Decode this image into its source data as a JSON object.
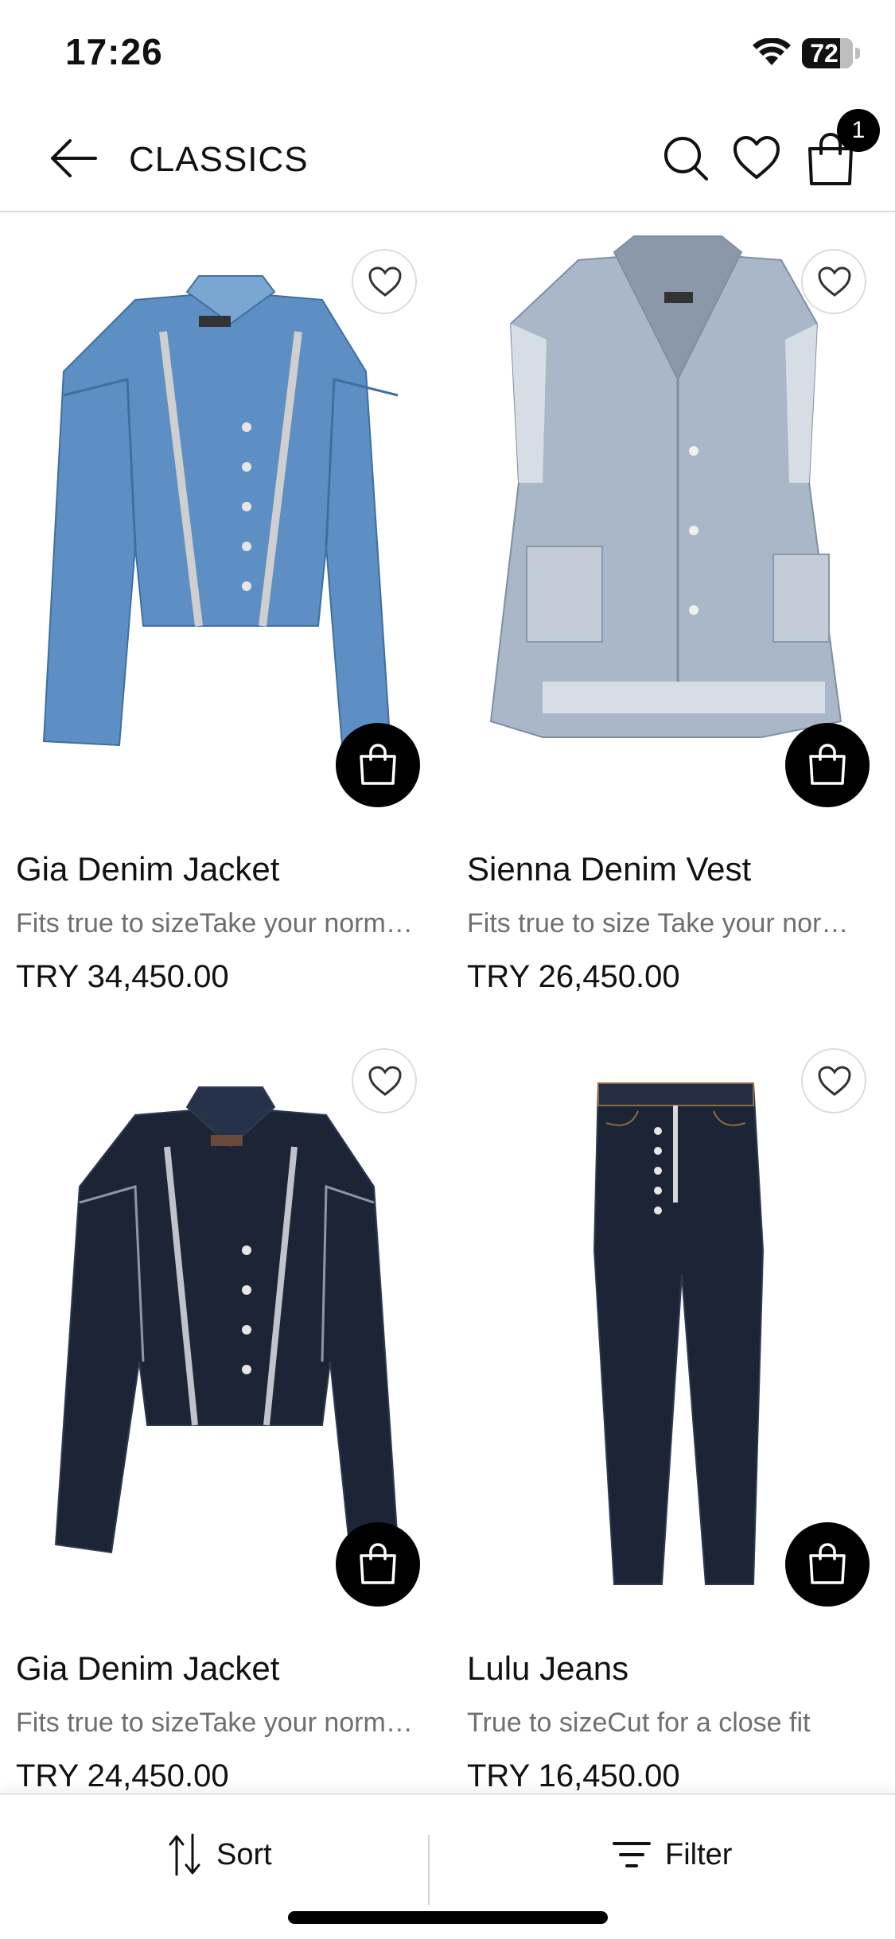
{
  "status_bar": {
    "time": "17:26",
    "battery": "72"
  },
  "header": {
    "title": "CLASSICS",
    "cart_count": "1"
  },
  "products": [
    {
      "name": "Gia Denim Jacket",
      "description": "Fits true to sizeTake your normal size",
      "price": "TRY 34,450.00",
      "image": "light-denim-jacket"
    },
    {
      "name": "Sienna Denim Vest",
      "description": "Fits true to size Take your normal size",
      "price": "TRY 26,450.00",
      "image": "grey-denim-vest"
    },
    {
      "name": "Gia Denim Jacket",
      "description": "Fits true to sizeTake your normal size",
      "price": "TRY 24,450.00",
      "image": "dark-denim-jacket"
    },
    {
      "name": "Lulu Jeans",
      "description": "True to sizeCut for a close fit",
      "price": "TRY 16,450.00",
      "image": "dark-skinny-jeans"
    }
  ],
  "bottom_bar": {
    "sort_label": "Sort",
    "filter_label": "Filter"
  },
  "colors": {
    "light_denim": "#5d8fc4",
    "grey_denim": "#a9b7c8",
    "dark_denim": "#1c2536",
    "accent": "#000000"
  }
}
